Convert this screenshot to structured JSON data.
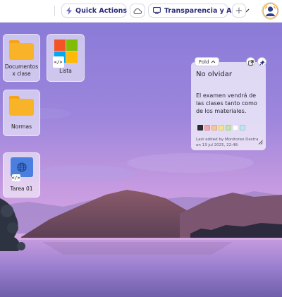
{
  "toolbar": {
    "quick_actions_label": "Quick Actions",
    "workspace_label": "Transparencia y AIP",
    "add_label": "+"
  },
  "desktop_icons": [
    {
      "label": "Documentos x clase",
      "icon": "folder-icon"
    },
    {
      "label": "Lista",
      "icon": "windows-logo-icon"
    },
    {
      "label": "Normas",
      "icon": "folder-icon"
    },
    {
      "label": "Tarea 01",
      "icon": "globe-icon"
    }
  ],
  "sticky_note": {
    "fold_label": "Fold",
    "title": "No olvidar",
    "body": "El examen vendrá de las clases tanto como de los materiales.",
    "footer": "Last edited by Monitoreo Destra on 13 jul 2025, 22:48.",
    "swatch_colors": [
      "#2b2b33",
      "#f4a6a6",
      "#f8c49a",
      "#f4e48a",
      "#bfe6a7",
      "#ffffff",
      "#bfe3f4"
    ]
  },
  "colors": {
    "accent": "#2c2f7a",
    "folder": "#f9b329",
    "windows_logo": [
      "#f35325",
      "#81bc06",
      "#05a6f0",
      "#ffba08"
    ],
    "globe_tile": "#4a7fe0"
  }
}
